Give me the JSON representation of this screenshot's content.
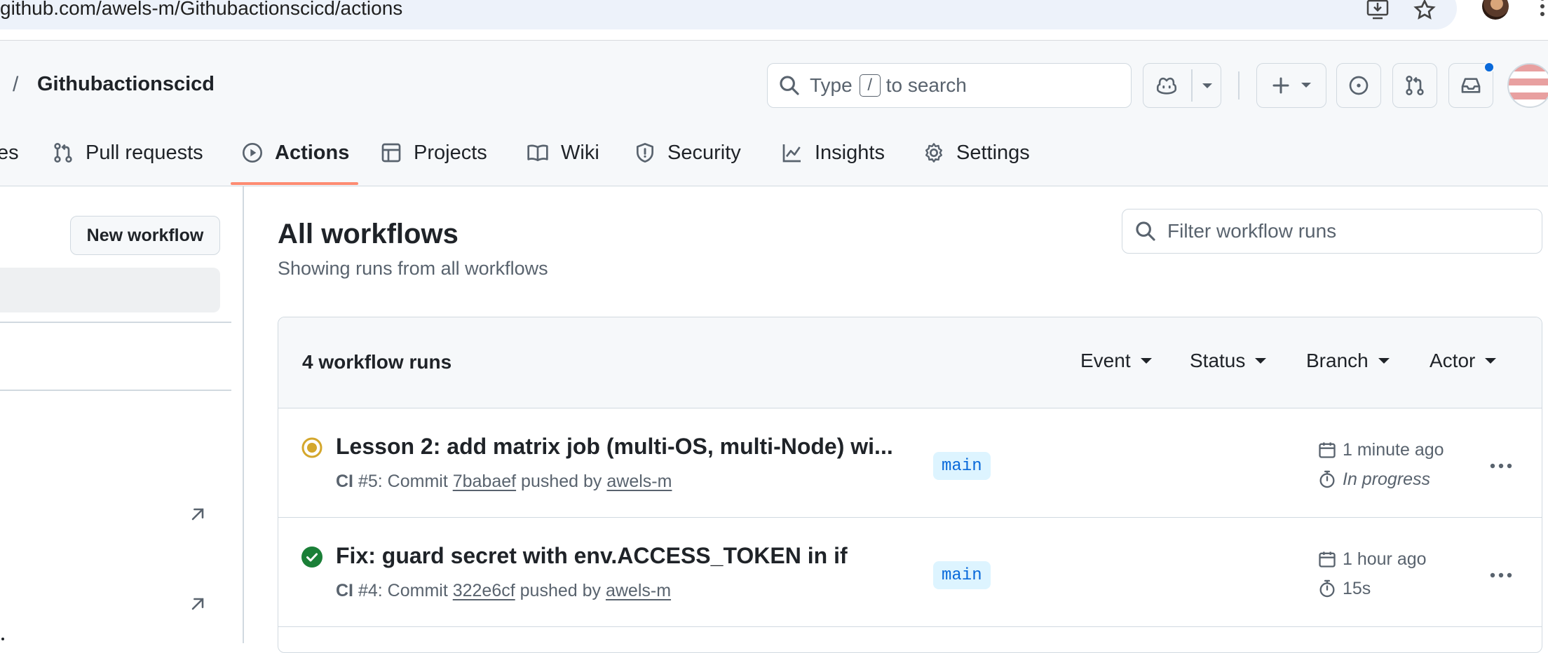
{
  "browser": {
    "url": "github.com/awels-m/Githubactionscicd/actions"
  },
  "header": {
    "repo_name": "Githubactionscicd",
    "separator": "/",
    "search_prefix": "Type",
    "search_key": "/",
    "search_suffix": "to search"
  },
  "tabs": [
    {
      "label": "es"
    },
    {
      "label": "Pull requests"
    },
    {
      "label": "Actions",
      "active": true
    },
    {
      "label": "Projects"
    },
    {
      "label": "Wiki"
    },
    {
      "label": "Security"
    },
    {
      "label": "Insights"
    },
    {
      "label": "Settings"
    }
  ],
  "sidebar": {
    "new_workflow_label": "New workflow"
  },
  "main": {
    "title": "All workflows",
    "subtitle": "Showing runs from all workflows",
    "filter_placeholder": "Filter workflow runs",
    "runs_count": "4 workflow runs",
    "filters": [
      "Event",
      "Status",
      "Branch",
      "Actor"
    ]
  },
  "runs": [
    {
      "status": "in-progress",
      "title": "Lesson 2: add matrix job (multi-OS, multi-Node) wi...",
      "workflow": "CI",
      "number": "#5",
      "commit_prefix": ": Commit",
      "commit": "7babaef",
      "pushed_by": "pushed by",
      "actor": "awels-m",
      "branch": "main",
      "time": "1 minute ago",
      "duration": "In progress"
    },
    {
      "status": "success",
      "title": "Fix: guard secret with env.ACCESS_TOKEN in if",
      "workflow": "CI",
      "number": "#4",
      "commit_prefix": ": Commit",
      "commit": "322e6cf",
      "pushed_by": "pushed by",
      "actor": "awels-m",
      "branch": "main",
      "time": "1 hour ago",
      "duration": "15s"
    }
  ],
  "colors": {
    "accent_blue": "#0969da",
    "success_green": "#1a7f37",
    "in_progress_yellow": "#d4a72c",
    "tab_underline": "#fd8c73"
  }
}
